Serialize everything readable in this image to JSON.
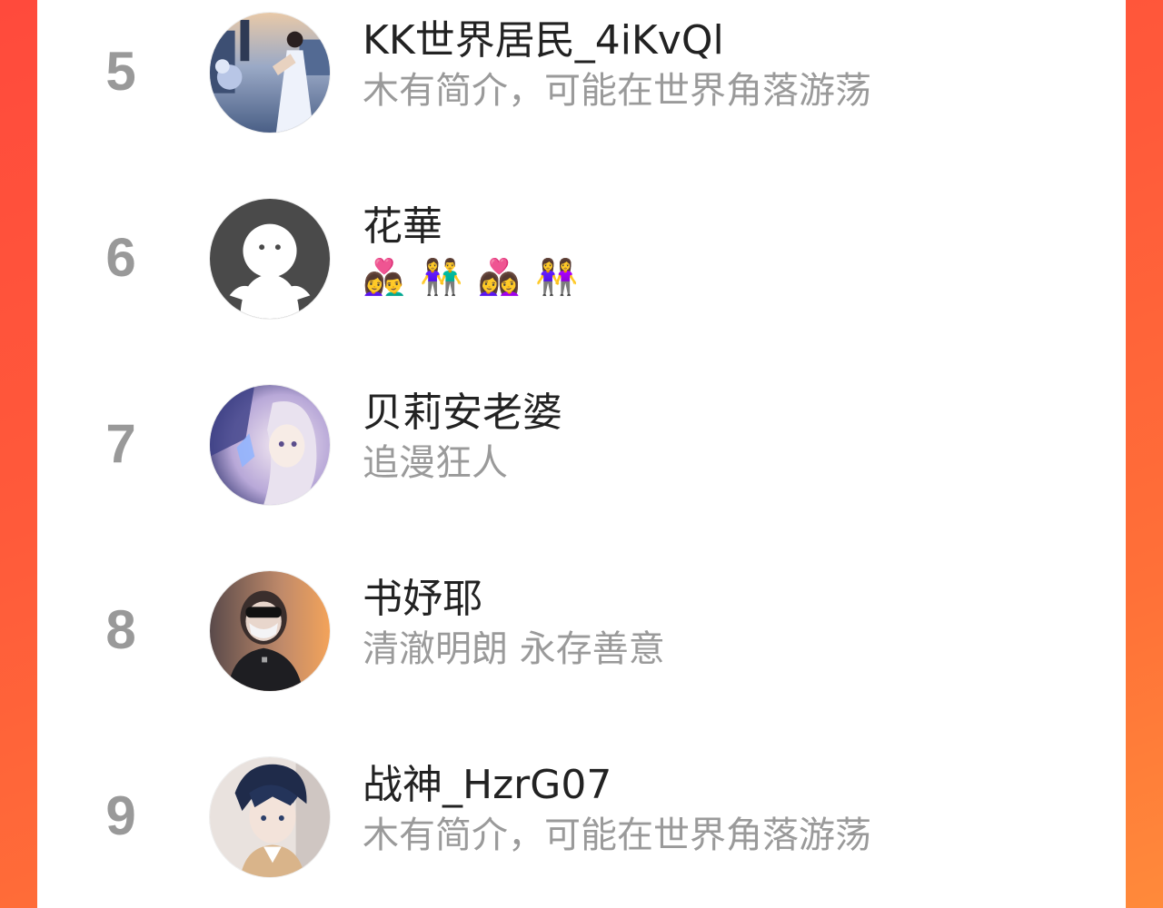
{
  "theme": {
    "background_gradient": [
      "#ff4a3c",
      "#ff8a3a"
    ],
    "panel": "#ffffff",
    "rank_color": "#999999",
    "name_color": "#222222",
    "bio_color": "#9a9a9a"
  },
  "leaderboard": {
    "rows": [
      {
        "rank": "5",
        "name": "KK世界居民_4iKvQl",
        "bio": "木有简介，可能在世界角落游荡",
        "avatar_icon": "photo-avatar-woman-white-dress"
      },
      {
        "rank": "6",
        "name": "花華",
        "bio": "👩‍❤️‍👨 👫 👩‍❤️‍👩 👭",
        "avatar_icon": "default-avatar-ghost"
      },
      {
        "rank": "7",
        "name": "贝莉安老婆",
        "bio": "追漫狂人",
        "avatar_icon": "anime-avatar-girl"
      },
      {
        "rank": "8",
        "name": "书妤耶",
        "bio": "清澈明朗 永存善意",
        "avatar_icon": "photo-avatar-masked-person"
      },
      {
        "rank": "9",
        "name": "战神_HzrG07",
        "bio": "木有简介，可能在世界角落游荡",
        "avatar_icon": "anime-avatar-boy"
      }
    ]
  }
}
